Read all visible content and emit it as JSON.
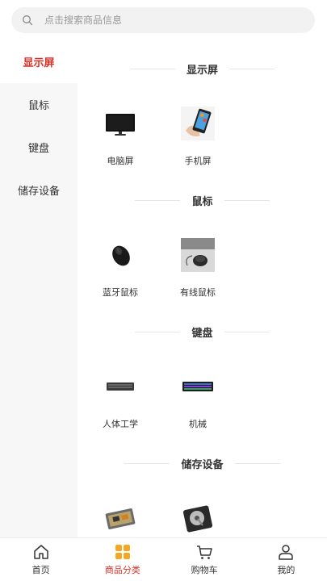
{
  "search": {
    "placeholder": "点击搜索商品信息",
    "value": ""
  },
  "sidebar": {
    "items": [
      {
        "label": "显示屏",
        "active": true
      },
      {
        "label": "鼠标",
        "active": false
      },
      {
        "label": "键盘",
        "active": false
      },
      {
        "label": "储存设备",
        "active": false
      }
    ]
  },
  "sections": [
    {
      "title": "显示屏",
      "products": [
        {
          "name": "电脑屏",
          "icon": "monitor-image"
        },
        {
          "name": "手机屏",
          "icon": "phone-image"
        }
      ]
    },
    {
      "title": "鼠标",
      "products": [
        {
          "name": "蓝牙鼠标",
          "icon": "bluetooth-mouse-image"
        },
        {
          "name": "有线鼠标",
          "icon": "wired-mouse-image"
        }
      ]
    },
    {
      "title": "键盘",
      "products": [
        {
          "name": "人体工学",
          "icon": "ergonomic-keyboard-image"
        },
        {
          "name": "机械",
          "icon": "mechanical-keyboard-image"
        }
      ]
    },
    {
      "title": "储存设备",
      "products": [
        {
          "name": "",
          "icon": "memory-module-image"
        },
        {
          "name": "",
          "icon": "hard-drive-image"
        }
      ]
    }
  ],
  "tabbar": {
    "items": [
      {
        "label": "首页",
        "icon": "home-icon",
        "active": false
      },
      {
        "label": "商品分类",
        "icon": "category-icon",
        "active": true
      },
      {
        "label": "购物车",
        "icon": "cart-icon",
        "active": false
      },
      {
        "label": "我的",
        "icon": "user-icon",
        "active": false
      }
    ]
  },
  "colors": {
    "accent": "#e02e24",
    "sidebar_bg": "#f7f7f7",
    "search_bg": "#f2f2f2"
  }
}
